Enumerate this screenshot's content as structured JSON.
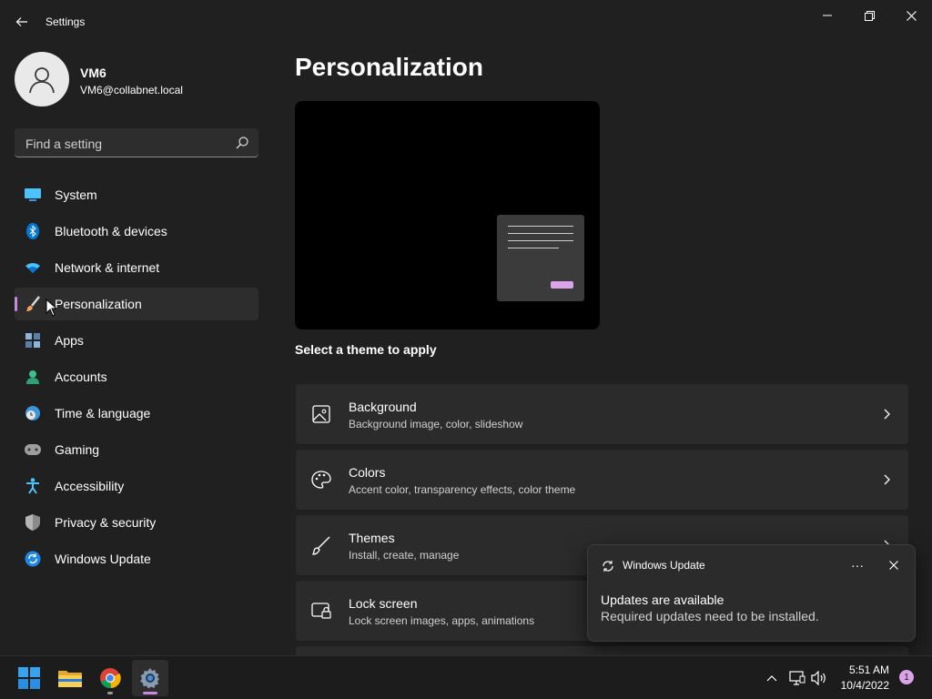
{
  "window": {
    "title": "Settings",
    "controls": [
      "minimize",
      "restore",
      "close"
    ]
  },
  "profile": {
    "name": "VM6",
    "email": "VM6@collabnet.local"
  },
  "search": {
    "placeholder": "Find a setting"
  },
  "sidebar": {
    "selected": "Personalization",
    "items": [
      {
        "label": "System",
        "icon": "system-icon"
      },
      {
        "label": "Bluetooth & devices",
        "icon": "bluetooth-icon"
      },
      {
        "label": "Network & internet",
        "icon": "wifi-icon"
      },
      {
        "label": "Personalization",
        "icon": "brush-icon"
      },
      {
        "label": "Apps",
        "icon": "apps-icon"
      },
      {
        "label": "Accounts",
        "icon": "accounts-icon"
      },
      {
        "label": "Time & language",
        "icon": "clock-globe-icon"
      },
      {
        "label": "Gaming",
        "icon": "gamepad-icon"
      },
      {
        "label": "Accessibility",
        "icon": "accessibility-icon"
      },
      {
        "label": "Privacy & security",
        "icon": "shield-icon"
      },
      {
        "label": "Windows Update",
        "icon": "update-icon"
      }
    ]
  },
  "main": {
    "title": "Personalization",
    "theme_label": "Select a theme to apply",
    "cards": [
      {
        "title": "Background",
        "subtitle": "Background image, color, slideshow",
        "icon": "picture-icon"
      },
      {
        "title": "Colors",
        "subtitle": "Accent color, transparency effects, color theme",
        "icon": "palette-icon"
      },
      {
        "title": "Themes",
        "subtitle": "Install, create, manage",
        "icon": "pen-brush-icon"
      },
      {
        "title": "Lock screen",
        "subtitle": "Lock screen images, apps, animations",
        "icon": "lock-screen-icon"
      }
    ]
  },
  "toast": {
    "app": "Windows Update",
    "heading": "Updates are available",
    "body": "Required updates need to be installed.",
    "more": "···"
  },
  "taskbar": {
    "apps": [
      "start-icon",
      "file-explorer-icon",
      "chrome-icon",
      "settings-icon"
    ],
    "time": "5:51 AM",
    "date": "10/4/2022",
    "notifications": "1"
  },
  "colors": {
    "background": "#202020",
    "accent": "#c989e0",
    "card": "#2b2b2b"
  }
}
